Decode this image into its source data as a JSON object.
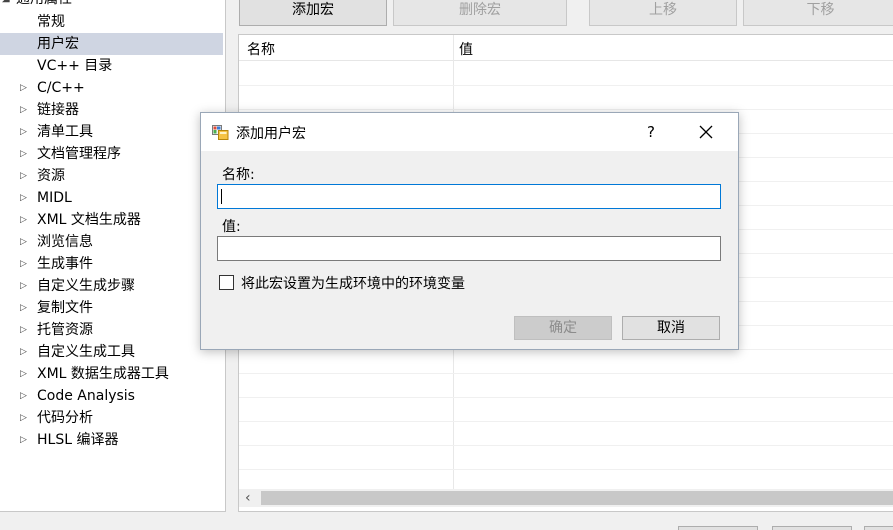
{
  "tree": {
    "root_label": "通用属性",
    "items": [
      {
        "label": "常规",
        "expandable": false,
        "selected": false
      },
      {
        "label": "用户宏",
        "expandable": false,
        "selected": true
      },
      {
        "label": "VC++ 目录",
        "expandable": false,
        "selected": false
      },
      {
        "label": "C/C++",
        "expandable": true,
        "selected": false
      },
      {
        "label": "链接器",
        "expandable": true,
        "selected": false
      },
      {
        "label": "清单工具",
        "expandable": true,
        "selected": false
      },
      {
        "label": "文档管理程序",
        "expandable": true,
        "selected": false
      },
      {
        "label": "资源",
        "expandable": true,
        "selected": false
      },
      {
        "label": "MIDL",
        "expandable": true,
        "selected": false
      },
      {
        "label": "XML 文档生成器",
        "expandable": true,
        "selected": false
      },
      {
        "label": "浏览信息",
        "expandable": true,
        "selected": false
      },
      {
        "label": "生成事件",
        "expandable": true,
        "selected": false
      },
      {
        "label": "自定义生成步骤",
        "expandable": true,
        "selected": false
      },
      {
        "label": "复制文件",
        "expandable": true,
        "selected": false
      },
      {
        "label": "托管资源",
        "expandable": true,
        "selected": false
      },
      {
        "label": "自定义生成工具",
        "expandable": true,
        "selected": false
      },
      {
        "label": "XML 数据生成器工具",
        "expandable": true,
        "selected": false
      },
      {
        "label": "Code Analysis",
        "expandable": true,
        "selected": false
      },
      {
        "label": "代码分析",
        "expandable": true,
        "selected": false
      },
      {
        "label": "HLSL 编译器",
        "expandable": true,
        "selected": false
      }
    ]
  },
  "toolbar": {
    "add_macro": "添加宏",
    "delete_macro": "删除宏",
    "move_up": "上移",
    "move_down": "下移"
  },
  "grid": {
    "col_name": "名称",
    "col_value": "值"
  },
  "dialog": {
    "title": "添加用户宏",
    "help": "?",
    "name_label": "名称:",
    "name_value": "",
    "value_label": "值:",
    "value_value": "",
    "checkbox_label": "将此宏设置为生成环境中的环境变量",
    "checkbox_checked": false,
    "ok_label": "确定",
    "cancel_label": "取消"
  },
  "icons": {
    "tree_collapsed": "triangle-right-icon",
    "tree_expanded": "triangle-down-icon",
    "close": "close-icon",
    "scroll_left": "chevron-left-icon",
    "dialog_app": "app-window-icon"
  },
  "colors": {
    "selection": "#cfd5e2",
    "focus_border": "#0078d7",
    "disabled_text": "#a0a0a0"
  }
}
